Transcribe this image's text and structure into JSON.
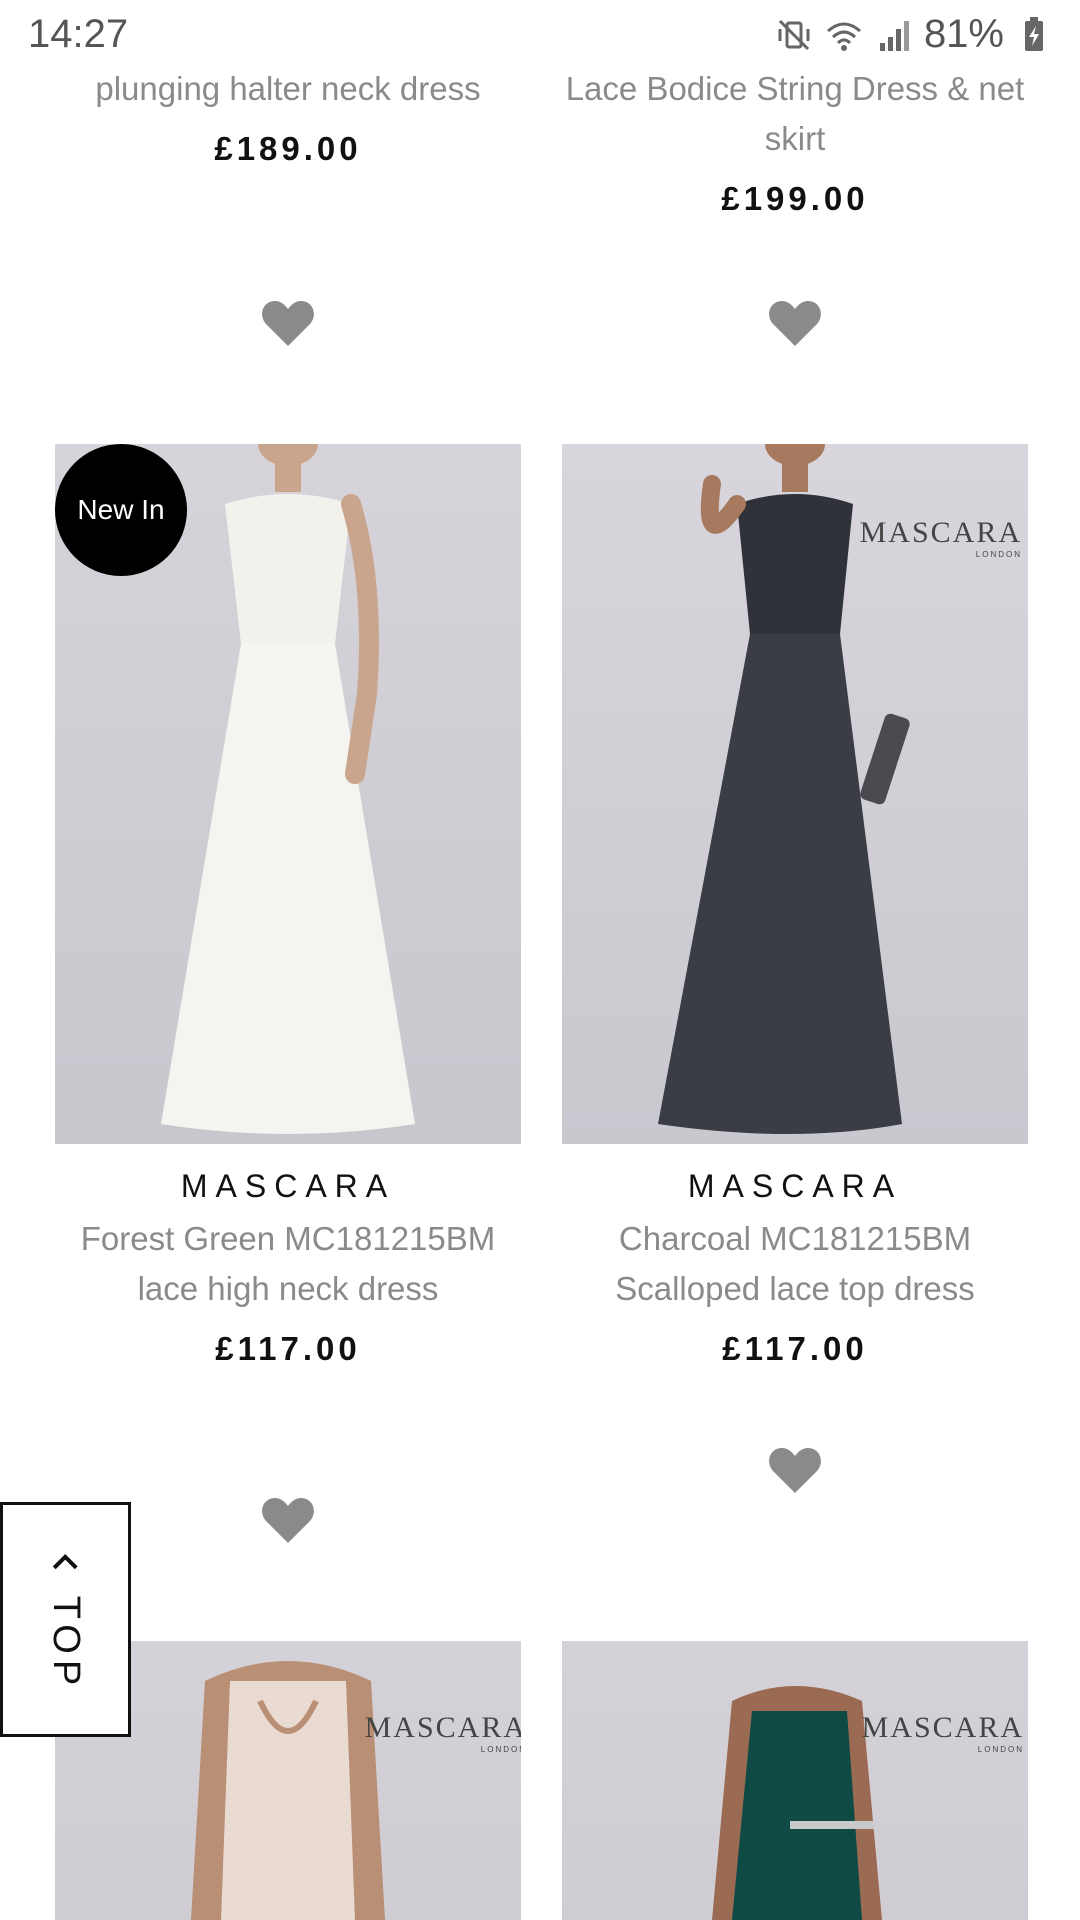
{
  "status_bar": {
    "time": "14:27",
    "battery_percent": "81%",
    "icons": [
      "vibrate-mute-icon",
      "wifi-icon",
      "signal-icon",
      "battery-charging-icon"
    ]
  },
  "products_top_row": [
    {
      "title": "plunging halter neck dress",
      "price": "£189.00"
    },
    {
      "title": "Lace Bodice String Dress & net skirt",
      "price": "£199.00"
    }
  ],
  "products_middle_row": [
    {
      "badge": "New In",
      "brand": "MASCARA",
      "title": "Forest Green MC181215BM lace high neck dress",
      "price": "£117.00",
      "dress_color": "#f4f2ee"
    },
    {
      "brand": "MASCARA",
      "title": "Charcoal MC181215BM Scalloped lace top dress",
      "price": "£117.00",
      "logo": "MASCARA",
      "logo_sub": "LONDON",
      "dress_color": "#3a3d44"
    }
  ],
  "products_bottom_row": [
    {
      "logo": "MASCARA",
      "logo_sub": "LONDON",
      "dress_color": "#eadbd2"
    },
    {
      "logo": "MASCARA",
      "logo_sub": "LONDON",
      "dress_color": "#0f4a45"
    }
  ],
  "back_to_top": {
    "label": "TOP"
  },
  "colors": {
    "heart": "#8a8a8a",
    "text_muted": "#8a8a8a",
    "badge_bg": "#000000"
  }
}
